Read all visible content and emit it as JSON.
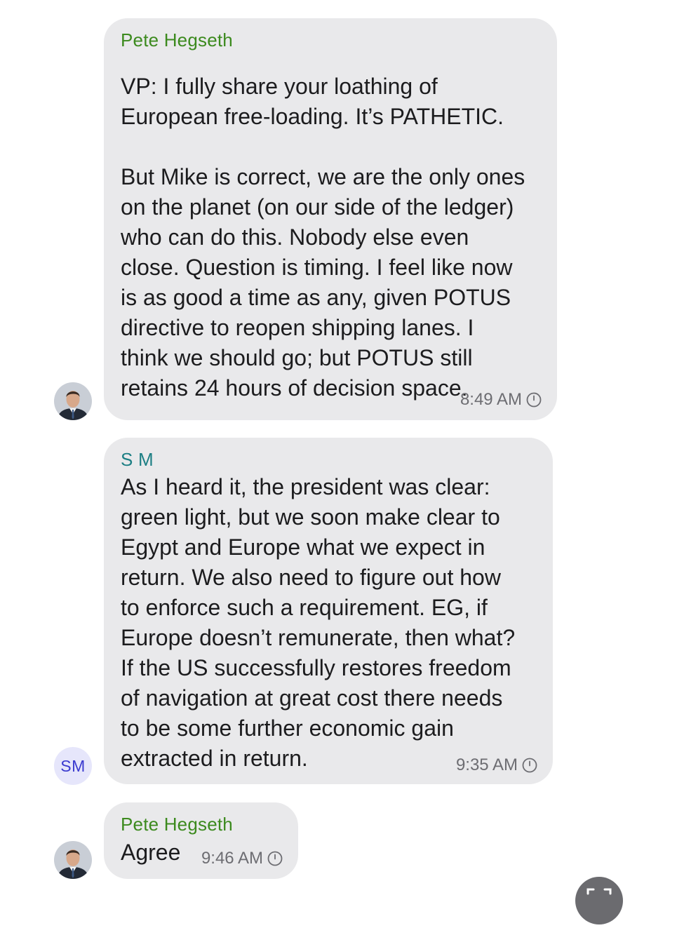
{
  "messages": [
    {
      "sender": "Pete Hegseth",
      "text": "VP: I fully share your loathing of\nEuropean free-loading. It’s PATHETIC.\n\nBut Mike is correct, we are the only ones\non the planet (on our side of the ledger)\nwho can do this. Nobody else even\nclose. Question is timing. I feel like now\nis as good a time as any, given POTUS\ndirective to reopen shipping lanes. I\nthink we should go; but POTUS still\nretains 24 hours of decision space.",
      "time": "8:49 AM"
    },
    {
      "sender": "S M",
      "avatar_initials": "SM",
      "text": "As I heard it, the president was clear:\ngreen light, but we soon make clear to\nEgypt and Europe what we expect in\nreturn. We also need to figure out how\nto enforce such a requirement. EG, if\nEurope doesn’t remunerate, then what?\nIf the US successfully restores freedom\nof navigation at great cost there needs\nto be some further economic gain\nextracted in return.",
      "time": "9:35 AM"
    },
    {
      "sender": "Pete Hegseth",
      "text": "Agree",
      "time": "9:46 AM"
    }
  ],
  "colors": {
    "bubble": "#e9e9eb",
    "sender_green": "#3c8a1e",
    "sender_teal": "#1d7f84",
    "timestamp": "#6d6d72",
    "initials_avatar_bg": "#e6e6fb",
    "initials_avatar_text": "#3b3bd0"
  },
  "icons": {
    "timer": "clock-icon",
    "avatar": "person-photo-avatar",
    "fab": "expand-icon"
  }
}
